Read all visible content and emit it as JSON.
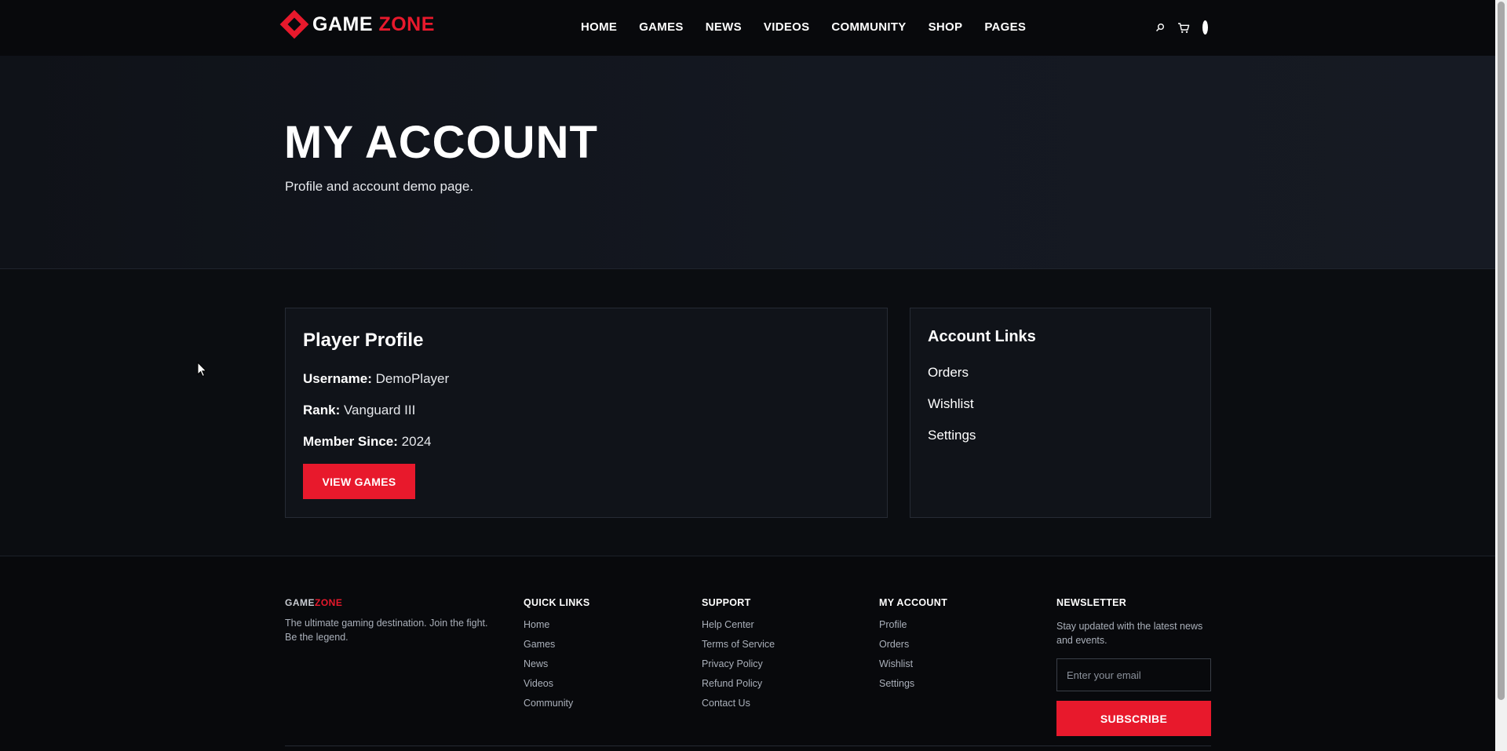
{
  "brand": {
    "name_white": "GAME",
    "name_red": "ZONE",
    "accent_color": "#e8192c"
  },
  "nav": {
    "items": [
      "HOME",
      "GAMES",
      "NEWS",
      "VIDEOS",
      "COMMUNITY",
      "SHOP",
      "PAGES"
    ]
  },
  "header_icons": [
    "search-icon",
    "cart-icon",
    "user-dot-icon"
  ],
  "hero": {
    "title": "MY ACCOUNT",
    "subtitle": "Profile and account demo page."
  },
  "profile": {
    "heading": "Player Profile",
    "username_label": "Username:",
    "username_value": "DemoPlayer",
    "rank_label": "Rank:",
    "rank_value": "Vanguard III",
    "member_label": "Member Since:",
    "member_value": "2024",
    "button_label": "VIEW GAMES"
  },
  "account_links": {
    "heading": "Account Links",
    "items": [
      "Orders",
      "Wishlist",
      "Settings"
    ]
  },
  "footer": {
    "brand_white": "GAME",
    "brand_red": "ZONE",
    "description": "The ultimate gaming destination. Join the fight. Be the legend.",
    "quick_links": {
      "heading": "QUICK LINKS",
      "items": [
        "Home",
        "Games",
        "News",
        "Videos",
        "Community"
      ]
    },
    "support": {
      "heading": "SUPPORT",
      "items": [
        "Help Center",
        "Terms of Service",
        "Privacy Policy",
        "Refund Policy",
        "Contact Us"
      ]
    },
    "my_account": {
      "heading": "MY ACCOUNT",
      "items": [
        "Profile",
        "Orders",
        "Wishlist",
        "Settings"
      ]
    },
    "newsletter": {
      "heading": "NEWSLETTER",
      "text": "Stay updated with the latest news and events.",
      "email_placeholder": "Enter your email",
      "email_value": "",
      "button_label": "SUBSCRIBE"
    }
  }
}
